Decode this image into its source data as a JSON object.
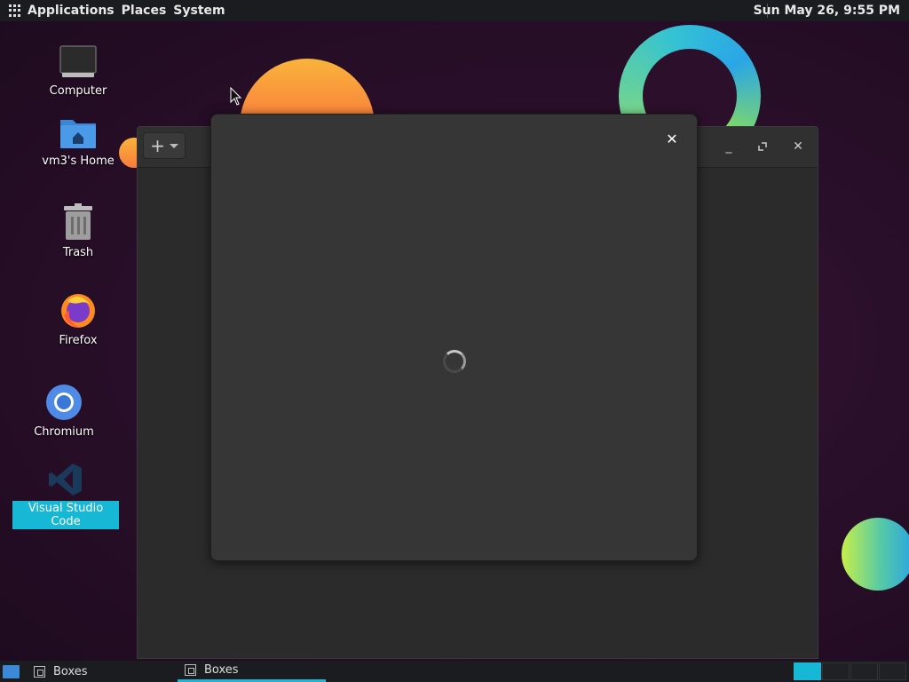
{
  "top_panel": {
    "menus": [
      "Applications",
      "Places",
      "System"
    ],
    "clock": "Sun May 26,  9:55 PM"
  },
  "desktop": {
    "icons": [
      {
        "label": "Computer",
        "icon": "computer-icon"
      },
      {
        "label": "vm3's Home",
        "icon": "home-folder-icon"
      },
      {
        "label": "Trash",
        "icon": "trash-icon"
      },
      {
        "label": "Firefox",
        "icon": "firefox-icon"
      },
      {
        "label": "Chromium",
        "icon": "chromium-icon"
      },
      {
        "label": "Visual Studio Code",
        "icon": "vscode-icon",
        "selected": true
      }
    ]
  },
  "boxes_window": {
    "new_button_icon": "plus-icon",
    "controls": [
      "minimize-icon",
      "maximize-icon",
      "close-icon"
    ]
  },
  "dialog": {
    "close_icon": "close-icon",
    "state": "loading"
  },
  "taskbar": {
    "tasks": [
      {
        "label": "Boxes",
        "active": false
      },
      {
        "label": "Boxes",
        "active": true
      }
    ],
    "workspaces": 4,
    "active_workspace": 1
  },
  "colors": {
    "accent": "#16b8d6",
    "panel": "#1b1c1f",
    "dialog_bg": "#363636"
  }
}
